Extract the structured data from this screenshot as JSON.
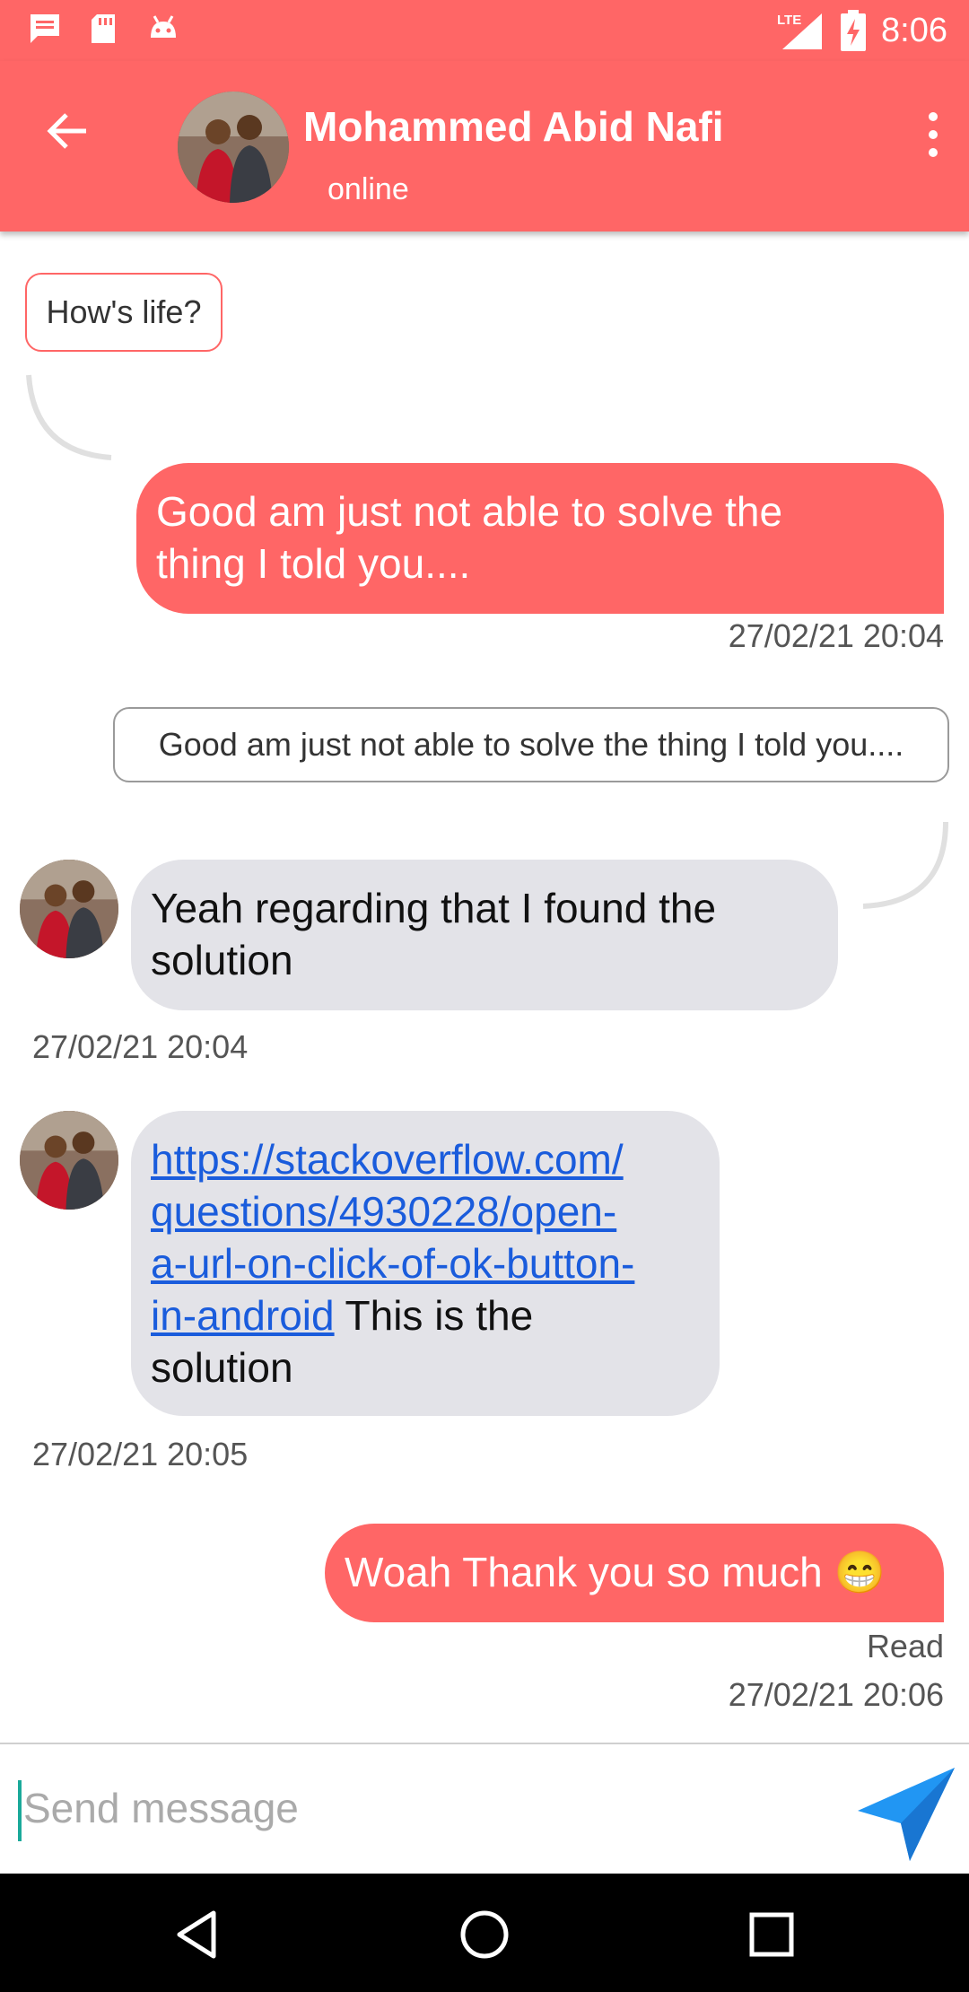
{
  "status_bar": {
    "time": "8:06",
    "network": "LTE",
    "icons": [
      "message-icon",
      "sd-card-icon",
      "android-icon",
      "lte-signal-icon",
      "battery-charging-icon"
    ]
  },
  "header": {
    "contact_name": "Mohammed Abid Nafi",
    "status": "online",
    "back_icon": "arrow-left-icon",
    "menu_icon": "more-vertical-icon"
  },
  "messages": [
    {
      "type": "quote_in",
      "text": "How's life?"
    },
    {
      "type": "sent",
      "lines": [
        "Good am just not able to solve the",
        "thing I told you...."
      ],
      "timestamp": "27/02/21  20:04"
    },
    {
      "type": "quote_out",
      "text": "Good am just not able to solve the thing I told you...."
    },
    {
      "type": "received",
      "lines": [
        "Yeah regarding that I found the",
        "solution"
      ],
      "timestamp": "27/02/21  20:04"
    },
    {
      "type": "received_link",
      "link_lines": [
        "https://stackoverflow.com/",
        "questions/4930228/open-",
        "a-url-on-click-of-ok-button-",
        "in-android"
      ],
      "tail": "This is the",
      "tail2": "solution",
      "timestamp": "27/02/21  20:05"
    },
    {
      "type": "sent",
      "text": "Woah Thank you so much 😁",
      "status": "Read",
      "timestamp": "27/02/21  20:06"
    }
  ],
  "composer": {
    "placeholder": "Send message",
    "send_icon": "send-icon"
  },
  "colors": {
    "primary": "#ff6666",
    "incoming_bubble": "#e3e3e8",
    "link": "#1a5cdc",
    "send_icon": "#2196f3"
  }
}
